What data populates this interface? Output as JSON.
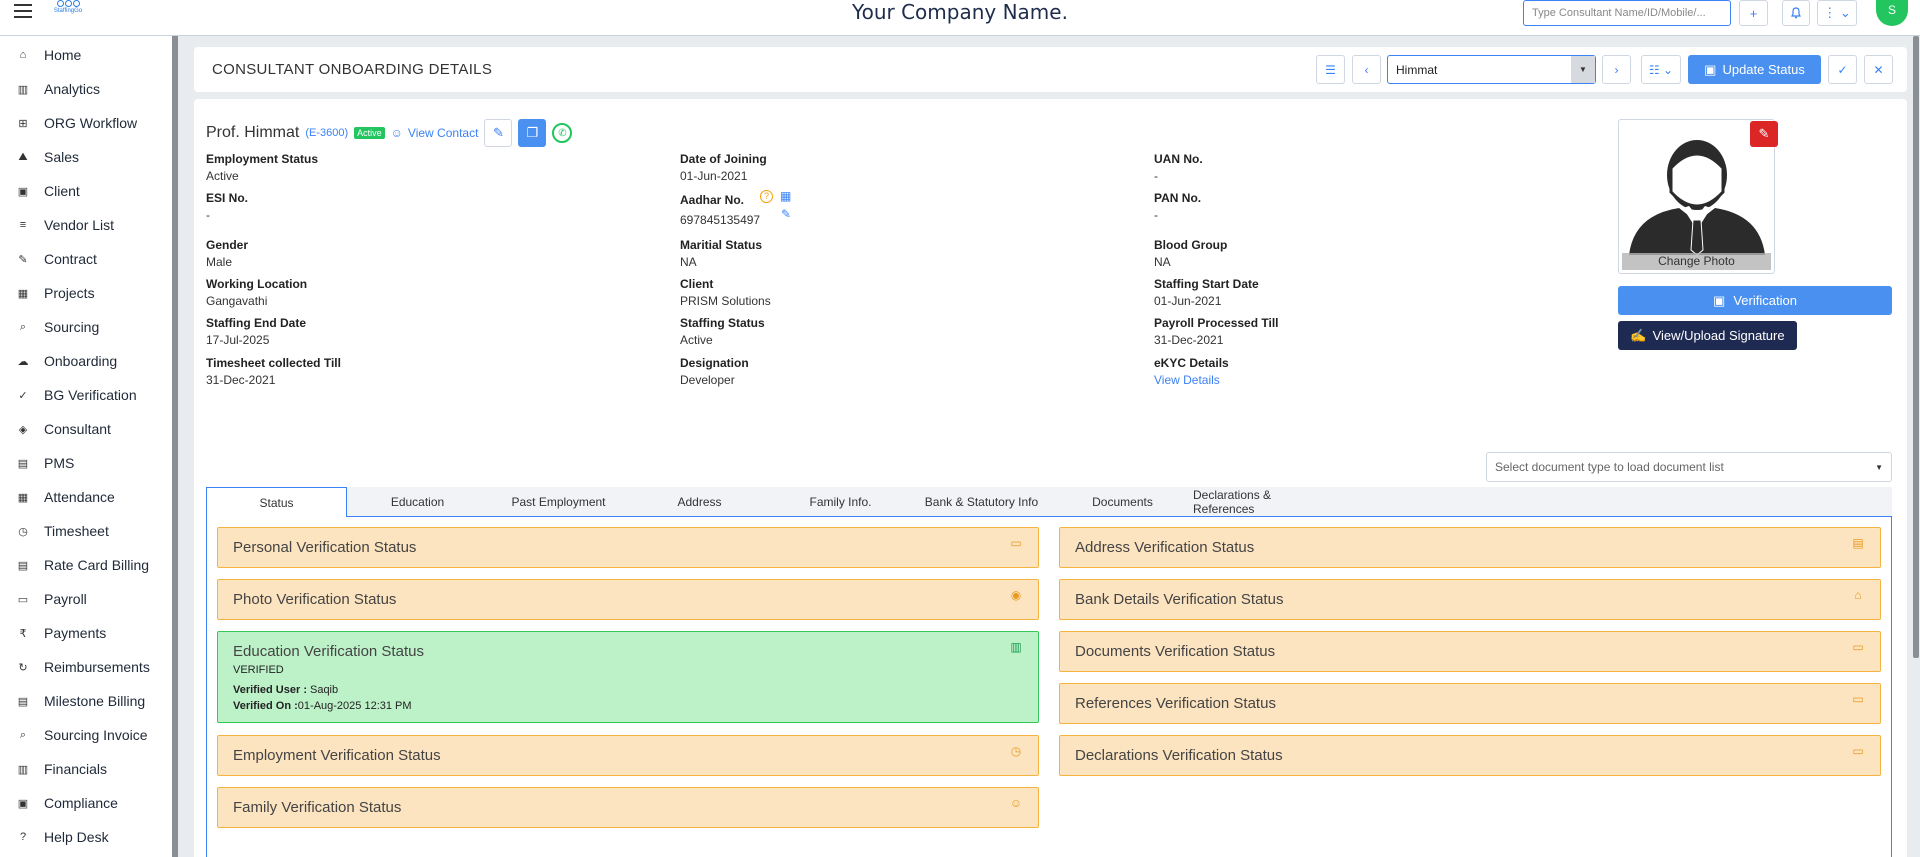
{
  "topbar": {
    "company_name": "Your Company Name.",
    "logo_text": "StaffingGo",
    "search_placeholder": "Type Consultant Name/ID/Mobile/...",
    "add_label": "+",
    "user_initial": "S"
  },
  "sidebar": {
    "items": [
      {
        "label": "Home",
        "icon": "home-icon"
      },
      {
        "label": "Analytics",
        "icon": "analytics-icon"
      },
      {
        "label": "ORG Workflow",
        "icon": "workflow-icon"
      },
      {
        "label": "Sales",
        "icon": "sales-icon"
      },
      {
        "label": "Client",
        "icon": "client-icon"
      },
      {
        "label": "Vendor List",
        "icon": "vendor-icon"
      },
      {
        "label": "Contract",
        "icon": "contract-icon"
      },
      {
        "label": "Projects",
        "icon": "projects-icon"
      },
      {
        "label": "Sourcing",
        "icon": "sourcing-icon"
      },
      {
        "label": "Onboarding",
        "icon": "onboarding-icon"
      },
      {
        "label": "BG Verification",
        "icon": "bg-verification-icon"
      },
      {
        "label": "Consultant",
        "icon": "consultant-icon"
      },
      {
        "label": "PMS",
        "icon": "pms-icon"
      },
      {
        "label": "Attendance",
        "icon": "calendar-icon"
      },
      {
        "label": "Timesheet",
        "icon": "timesheet-icon"
      },
      {
        "label": "Rate Card Billing",
        "icon": "rate-card-icon"
      },
      {
        "label": "Payroll",
        "icon": "payroll-icon"
      },
      {
        "label": "Payments",
        "icon": "rupee-icon"
      },
      {
        "label": "Reimbursements",
        "icon": "reimbursement-icon"
      },
      {
        "label": "Milestone Billing",
        "icon": "milestone-icon"
      },
      {
        "label": "Sourcing Invoice",
        "icon": "invoice-icon"
      },
      {
        "label": "Financials",
        "icon": "financials-icon"
      },
      {
        "label": "Compliance",
        "icon": "compliance-icon"
      },
      {
        "label": "Help Desk",
        "icon": "help-icon"
      }
    ]
  },
  "header": {
    "title": "CONSULTANT ONBOARDING DETAILS",
    "selected_consultant": "Himmat",
    "update_status_label": "Update Status"
  },
  "profile": {
    "name": "Prof. Himmat",
    "code": "(E-3600)",
    "status_badge": "Active",
    "view_contact_label": "View Contact"
  },
  "details": {
    "col1": [
      {
        "label": "Employment Status",
        "value": "Active"
      },
      {
        "label": "ESI No.",
        "value": "-"
      },
      {
        "label": "Gender",
        "value": "Male"
      },
      {
        "label": "Working Location",
        "value": "Gangavathi"
      },
      {
        "label": "Staffing End Date",
        "value": "17-Jul-2025"
      },
      {
        "label": "Timesheet collected Till",
        "value": "31-Dec-2021"
      }
    ],
    "col2": [
      {
        "label": "Date of Joining",
        "value": "01-Jun-2021"
      },
      {
        "label": "Aadhar No.",
        "value": "697845135497"
      },
      {
        "label": "Maritial Status",
        "value": "NA"
      },
      {
        "label": "Client",
        "value": "PRISM Solutions"
      },
      {
        "label": "Staffing Status",
        "value": "Active"
      },
      {
        "label": "Designation",
        "value": "Developer"
      }
    ],
    "col3": [
      {
        "label": "UAN No.",
        "value": "-"
      },
      {
        "label": "PAN No.",
        "value": "-"
      },
      {
        "label": "Blood Group",
        "value": "NA"
      },
      {
        "label": "Staffing Start Date",
        "value": "01-Jun-2021"
      },
      {
        "label": "Payroll Processed Till",
        "value": "31-Dec-2021"
      },
      {
        "label": "eKYC Details",
        "value": "View Details"
      }
    ]
  },
  "photo": {
    "change_label": "Change Photo"
  },
  "actions": {
    "verification_label": "Verification",
    "signature_label": "View/Upload Signature"
  },
  "document_select": {
    "placeholder": "Select document type to load document list"
  },
  "tabs": [
    "Status",
    "Education",
    "Past Employment",
    "Address",
    "Family Info.",
    "Bank & Statutory Info",
    "Documents",
    "Declarations & References"
  ],
  "verification": {
    "left": [
      {
        "title": "Personal Verification Status",
        "icon": "folder-icon"
      },
      {
        "title": "Photo Verification Status",
        "icon": "camera-icon"
      },
      {
        "title": "Education Verification Status",
        "icon": "book-icon",
        "status": "VERIFIED",
        "verified_user_label": "Verified User :",
        "verified_user": "Saqib",
        "verified_on_label": "Verified On :",
        "verified_on": "01-Aug-2025 12:31 PM"
      },
      {
        "title": "Employment Verification Status",
        "icon": "briefcase-clock-icon"
      },
      {
        "title": "Family Verification Status",
        "icon": "users-icon"
      }
    ],
    "right": [
      {
        "title": "Address Verification Status",
        "icon": "id-card-icon"
      },
      {
        "title": "Bank Details Verification Status",
        "icon": "bank-icon"
      },
      {
        "title": "Documents Verification Status",
        "icon": "folder-icon"
      },
      {
        "title": "References Verification Status",
        "icon": "folder-icon"
      },
      {
        "title": "Declarations Verification Status",
        "icon": "folder-icon"
      }
    ]
  },
  "colors": {
    "accent": "#4a90f0",
    "pending_bg": "#fde4c0",
    "verified_bg": "#bdf2c9",
    "dark_button": "#1e2a52"
  }
}
